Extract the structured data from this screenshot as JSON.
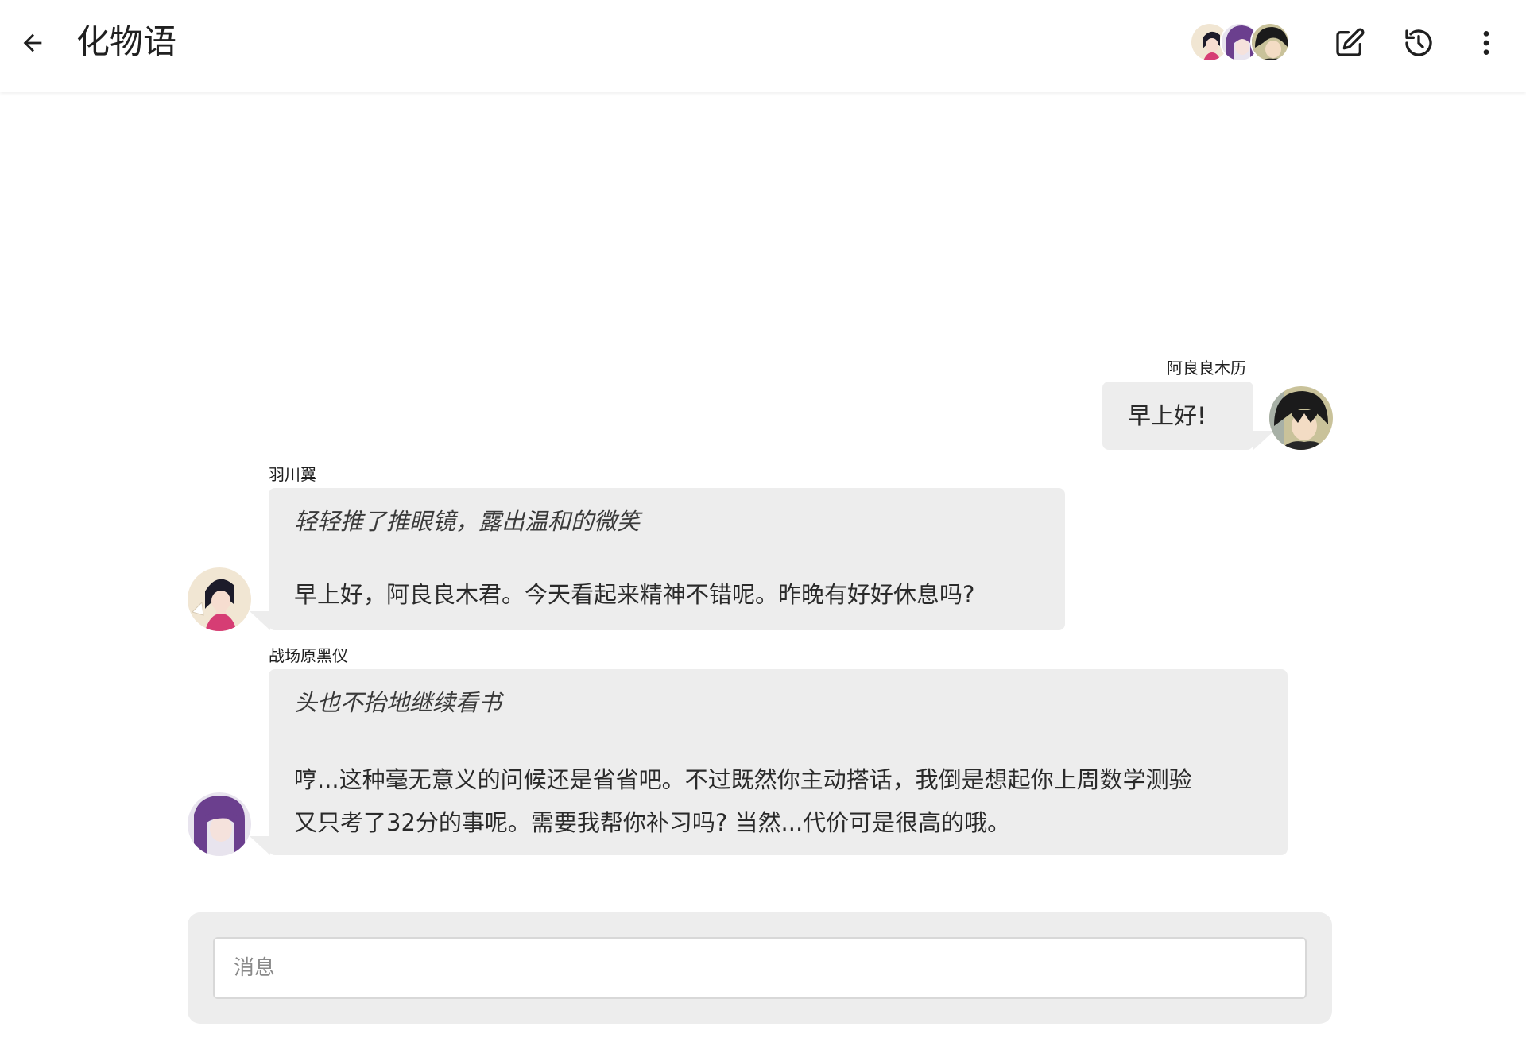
{
  "header": {
    "title": "化物语",
    "icons": {
      "back": "arrow-left-icon",
      "edit": "edit-square-icon",
      "history": "history-icon",
      "more": "more-vert-icon"
    }
  },
  "messages": [
    {
      "sender": "阿良良木历",
      "side": "right",
      "text": "早上好!"
    },
    {
      "sender": "羽川翼",
      "side": "left",
      "action": "轻轻推了推眼镜，露出温和的微笑",
      "text": "早上好，阿良良木君。今天看起来精神不错呢。昨晚有好好休息吗?"
    },
    {
      "sender": "战场原黑仪",
      "side": "left",
      "action": "头也不抬地继续看书",
      "text_line1": "哼...这种毫无意义的问候还是省省吧。不过既然你主动搭话，我倒是想起你上周数学测验",
      "text_line2": "又只考了32分的事呢。需要我帮你补习吗? 当然...代价可是很高的哦。"
    }
  ],
  "composer": {
    "placeholder": "消息"
  },
  "colors": {
    "bubble": "#ededed",
    "composer": "#ededed",
    "header_bg": "#ffffff"
  }
}
